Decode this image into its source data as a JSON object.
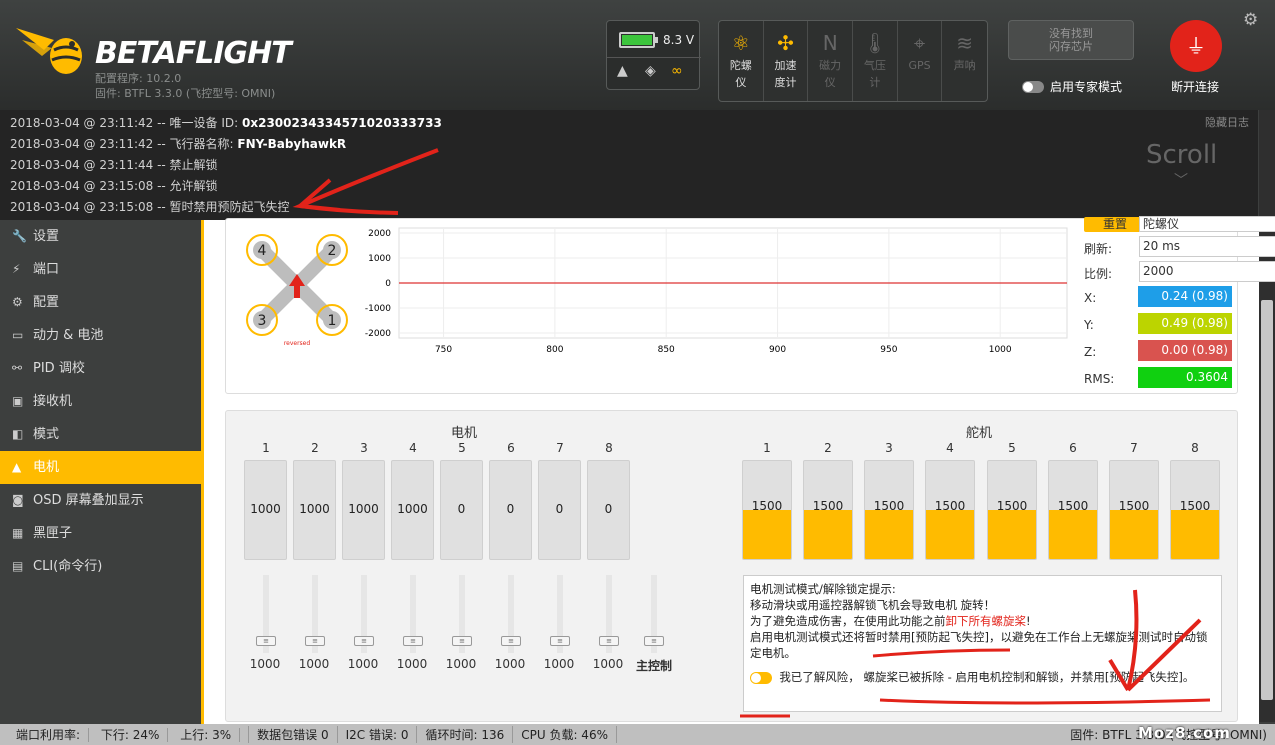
{
  "app": {
    "logo_text": "BETAFLIGHT",
    "config_version": "配置程序: 10.2.0",
    "firmware_version": "固件: BTFL 3.3.0 (飞控型号: OMNI)"
  },
  "battery": {
    "voltage": "8.3 V",
    "fill_color": "#3cc43c"
  },
  "sensors": [
    {
      "label": "陀螺\n仪",
      "icon": "gyro-icon",
      "active": true
    },
    {
      "label": "加速\n度计",
      "icon": "accel-icon",
      "active": true
    },
    {
      "label": "磁力\n仪",
      "icon": "mag-icon",
      "active": false
    },
    {
      "label": "气压\n计",
      "icon": "baro-icon",
      "active": false
    },
    {
      "label": "GPS",
      "icon": "gps-icon",
      "active": false
    },
    {
      "label": "声呐",
      "icon": "sonar-icon",
      "active": false
    }
  ],
  "header": {
    "dfu_line1": "没有找到",
    "dfu_line2": "闪存芯片",
    "expert_mode": "启用专家模式",
    "disconnect": "断开连接"
  },
  "log": {
    "hide": "隐藏日志",
    "scroll": "Scroll",
    "lines": [
      {
        "prefix": "2018-03-04 @ 23:11:42 -- 唯一设备 ID: ",
        "bold": "0x2300234334571020333733"
      },
      {
        "prefix": "2018-03-04 @ 23:11:42 -- 飞行器名称: ",
        "bold": "FNY-BabyhawkR"
      },
      {
        "prefix": "2018-03-04 @ 23:11:44 -- 禁止解锁",
        "bold": ""
      },
      {
        "prefix": "2018-03-04 @ 23:15:08 -- 允许解锁",
        "bold": ""
      },
      {
        "prefix": "2018-03-04 @ 23:15:08 -- 暂时禁用预防起飞失控",
        "bold": ""
      }
    ]
  },
  "sidebar": {
    "items": [
      {
        "label": "设置",
        "icon": "wrench-icon"
      },
      {
        "label": "端口",
        "icon": "plug-icon"
      },
      {
        "label": "配置",
        "icon": "gear-icon"
      },
      {
        "label": "动力 & 电池",
        "icon": "battery-icon"
      },
      {
        "label": "PID 调校",
        "icon": "pid-icon"
      },
      {
        "label": "接收机",
        "icon": "receiver-icon"
      },
      {
        "label": "模式",
        "icon": "toggle-icon"
      },
      {
        "label": "电机",
        "icon": "motor-icon",
        "active": true
      },
      {
        "label": "OSD 屏幕叠加显示",
        "icon": "osd-icon"
      },
      {
        "label": "黑匣子",
        "icon": "blackbox-icon"
      },
      {
        "label": "CLI(命令行)",
        "icon": "cli-icon"
      }
    ]
  },
  "quad": {
    "reversed": "reversed",
    "motors": [
      "4",
      "2",
      "3",
      "1"
    ]
  },
  "chart_data": {
    "type": "line",
    "x": [
      750,
      800,
      850,
      900,
      950,
      1000
    ],
    "yticks": [
      "2000",
      "1000",
      "0",
      "-1000",
      "-2000"
    ],
    "ylim": [
      -2000,
      2000
    ],
    "series_color": "#d33"
  },
  "graph_settings": {
    "reset": "重置",
    "sensor": "陀螺仪",
    "refresh_label": "刷新:",
    "refresh_value": "20 ms",
    "scale_label": "比例:",
    "scale_value": "2000",
    "x_label": "X:",
    "x_value": "0.24 (0.98)",
    "y_label": "Y:",
    "y_value": "0.49 (0.98)",
    "z_label": "Z:",
    "z_value": "0.00 (0.98)",
    "rms_label": "RMS:",
    "rms_value": "0.3604",
    "colors": {
      "x": "#1e9ee8",
      "y": "#bcd400",
      "z": "#d9534f",
      "rms": "#10d010"
    }
  },
  "motors": {
    "title": "电机",
    "numbers": [
      "1",
      "2",
      "3",
      "4",
      "5",
      "6",
      "7",
      "8"
    ],
    "values": [
      "1000",
      "1000",
      "1000",
      "1000",
      "0",
      "0",
      "0",
      "0"
    ],
    "slider_values": [
      "1000",
      "1000",
      "1000",
      "1000",
      "1000",
      "1000",
      "1000",
      "1000"
    ],
    "master": "主控制"
  },
  "servos": {
    "title": "舵机",
    "numbers": [
      "1",
      "2",
      "3",
      "4",
      "5",
      "6",
      "7",
      "8"
    ],
    "values": [
      "1500",
      "1500",
      "1500",
      "1500",
      "1500",
      "1500",
      "1500",
      "1500"
    ],
    "fill_fraction": 0.5
  },
  "notice": {
    "l1": "电机测试模式/解除锁定提示:",
    "l2": "移动滑块或用遥控器解锁飞机会导致电机 旋转！",
    "l3a": "为了避免造成伤害，在使用此功能之前",
    "l3b": "卸下所有螺旋桨",
    "l3c": "!",
    "l4": "启用电机测试模式还将暂时禁用[预防起飞失控]，以避免在工作台上无螺旋桨测试时自动锁定电机。",
    "ack": "我已了解风险，",
    "ack_b": "螺旋桨已被拆除 - 启用电机控制和解锁，并禁用[预防起飞失控]。"
  },
  "status": {
    "port": "端口利用率:",
    "down": "下行: 24%",
    "up": "上行: 3%",
    "packet": "数据包错误 0",
    "i2c": "I2C 错误: 0",
    "cycle": "循环时间: 136",
    "cpu": "CPU 负载: 46%",
    "firmware": "固件: BTFL 3.3.0 (飞控型号: OMNI)"
  },
  "watermark": "Moz8.com"
}
